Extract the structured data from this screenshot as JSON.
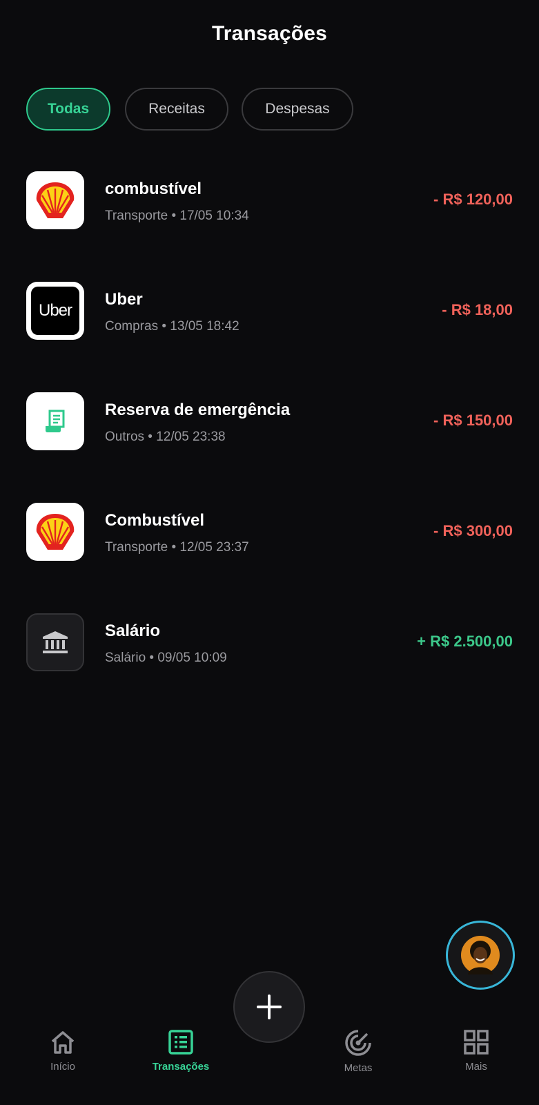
{
  "header": {
    "title": "Transações"
  },
  "filters": [
    {
      "label": "Todas",
      "active": true
    },
    {
      "label": "Receitas",
      "active": false
    },
    {
      "label": "Despesas",
      "active": false
    }
  ],
  "transactions": [
    {
      "name": "combustível",
      "meta": "Transporte • 17/05 10:34",
      "amount": "- R$ 120,00",
      "type": "expense",
      "icon": "shell-logo"
    },
    {
      "name": "Uber",
      "meta": "Compras • 13/05 18:42",
      "amount": "- R$ 18,00",
      "type": "expense",
      "icon": "uber-logo",
      "logo_text": "Uber"
    },
    {
      "name": "Reserva de emergência",
      "meta": "Outros • 12/05 23:38",
      "amount": "- R$ 150,00",
      "type": "expense",
      "icon": "receipt-icon"
    },
    {
      "name": "Combustível",
      "meta": "Transporte • 12/05 23:37",
      "amount": "- R$ 300,00",
      "type": "expense",
      "icon": "shell-logo"
    },
    {
      "name": "Salário",
      "meta": "Salário • 09/05 10:09",
      "amount": "+ R$ 2.500,00",
      "type": "income",
      "icon": "bank-icon"
    }
  ],
  "nav": [
    {
      "label": "Início",
      "icon": "home-icon",
      "active": false
    },
    {
      "label": "Transações",
      "icon": "list-icon",
      "active": true
    },
    {
      "label": "Metas",
      "icon": "target-icon",
      "active": false
    },
    {
      "label": "Mais",
      "icon": "grid-icon",
      "active": false
    }
  ],
  "colors": {
    "accent": "#37d396",
    "expense": "#f0625a",
    "income": "#3cc88a",
    "background": "#0b0b0d",
    "avatar_ring": "#38b6d8"
  }
}
